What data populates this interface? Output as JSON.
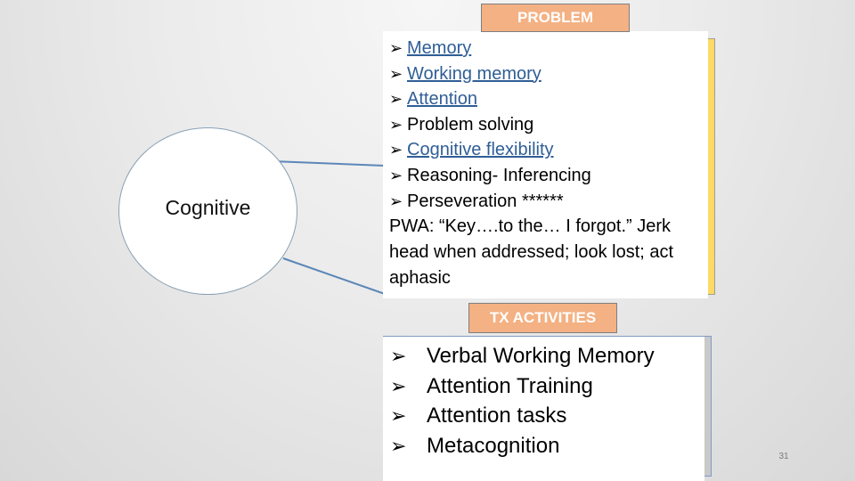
{
  "diagram": {
    "node": {
      "label": "Cognitive"
    },
    "problem": {
      "header": "PROBLEM",
      "items": [
        {
          "text": "Memory",
          "link": true
        },
        {
          "text": "Working memory",
          "link": true
        },
        {
          "text": "Attention",
          "link": true
        },
        {
          "text": "Problem solving",
          "link": false
        },
        {
          "text": "Cognitive flexibility",
          "link": true
        },
        {
          "text": "Reasoning- Inferencing",
          "link": false
        },
        {
          "text": "Perseveration  ******",
          "link": false
        }
      ],
      "note": "PWA: “Key….to the… I forgot.” Jerk head when addressed; look lost; act aphasic"
    },
    "tx_activities": {
      "header": "TX ACTIVITIES",
      "items": [
        "Verbal Working Memory",
        "Attention Training",
        "Attention tasks",
        "Metacognition"
      ]
    },
    "bullet_icon": "arrowhead-bullet",
    "colors": {
      "header_fill": "#f4b183",
      "accent_yellow": "#ffd966",
      "link": "#2f5e96",
      "connector": "#5b87b8"
    }
  },
  "slide_number": "31"
}
